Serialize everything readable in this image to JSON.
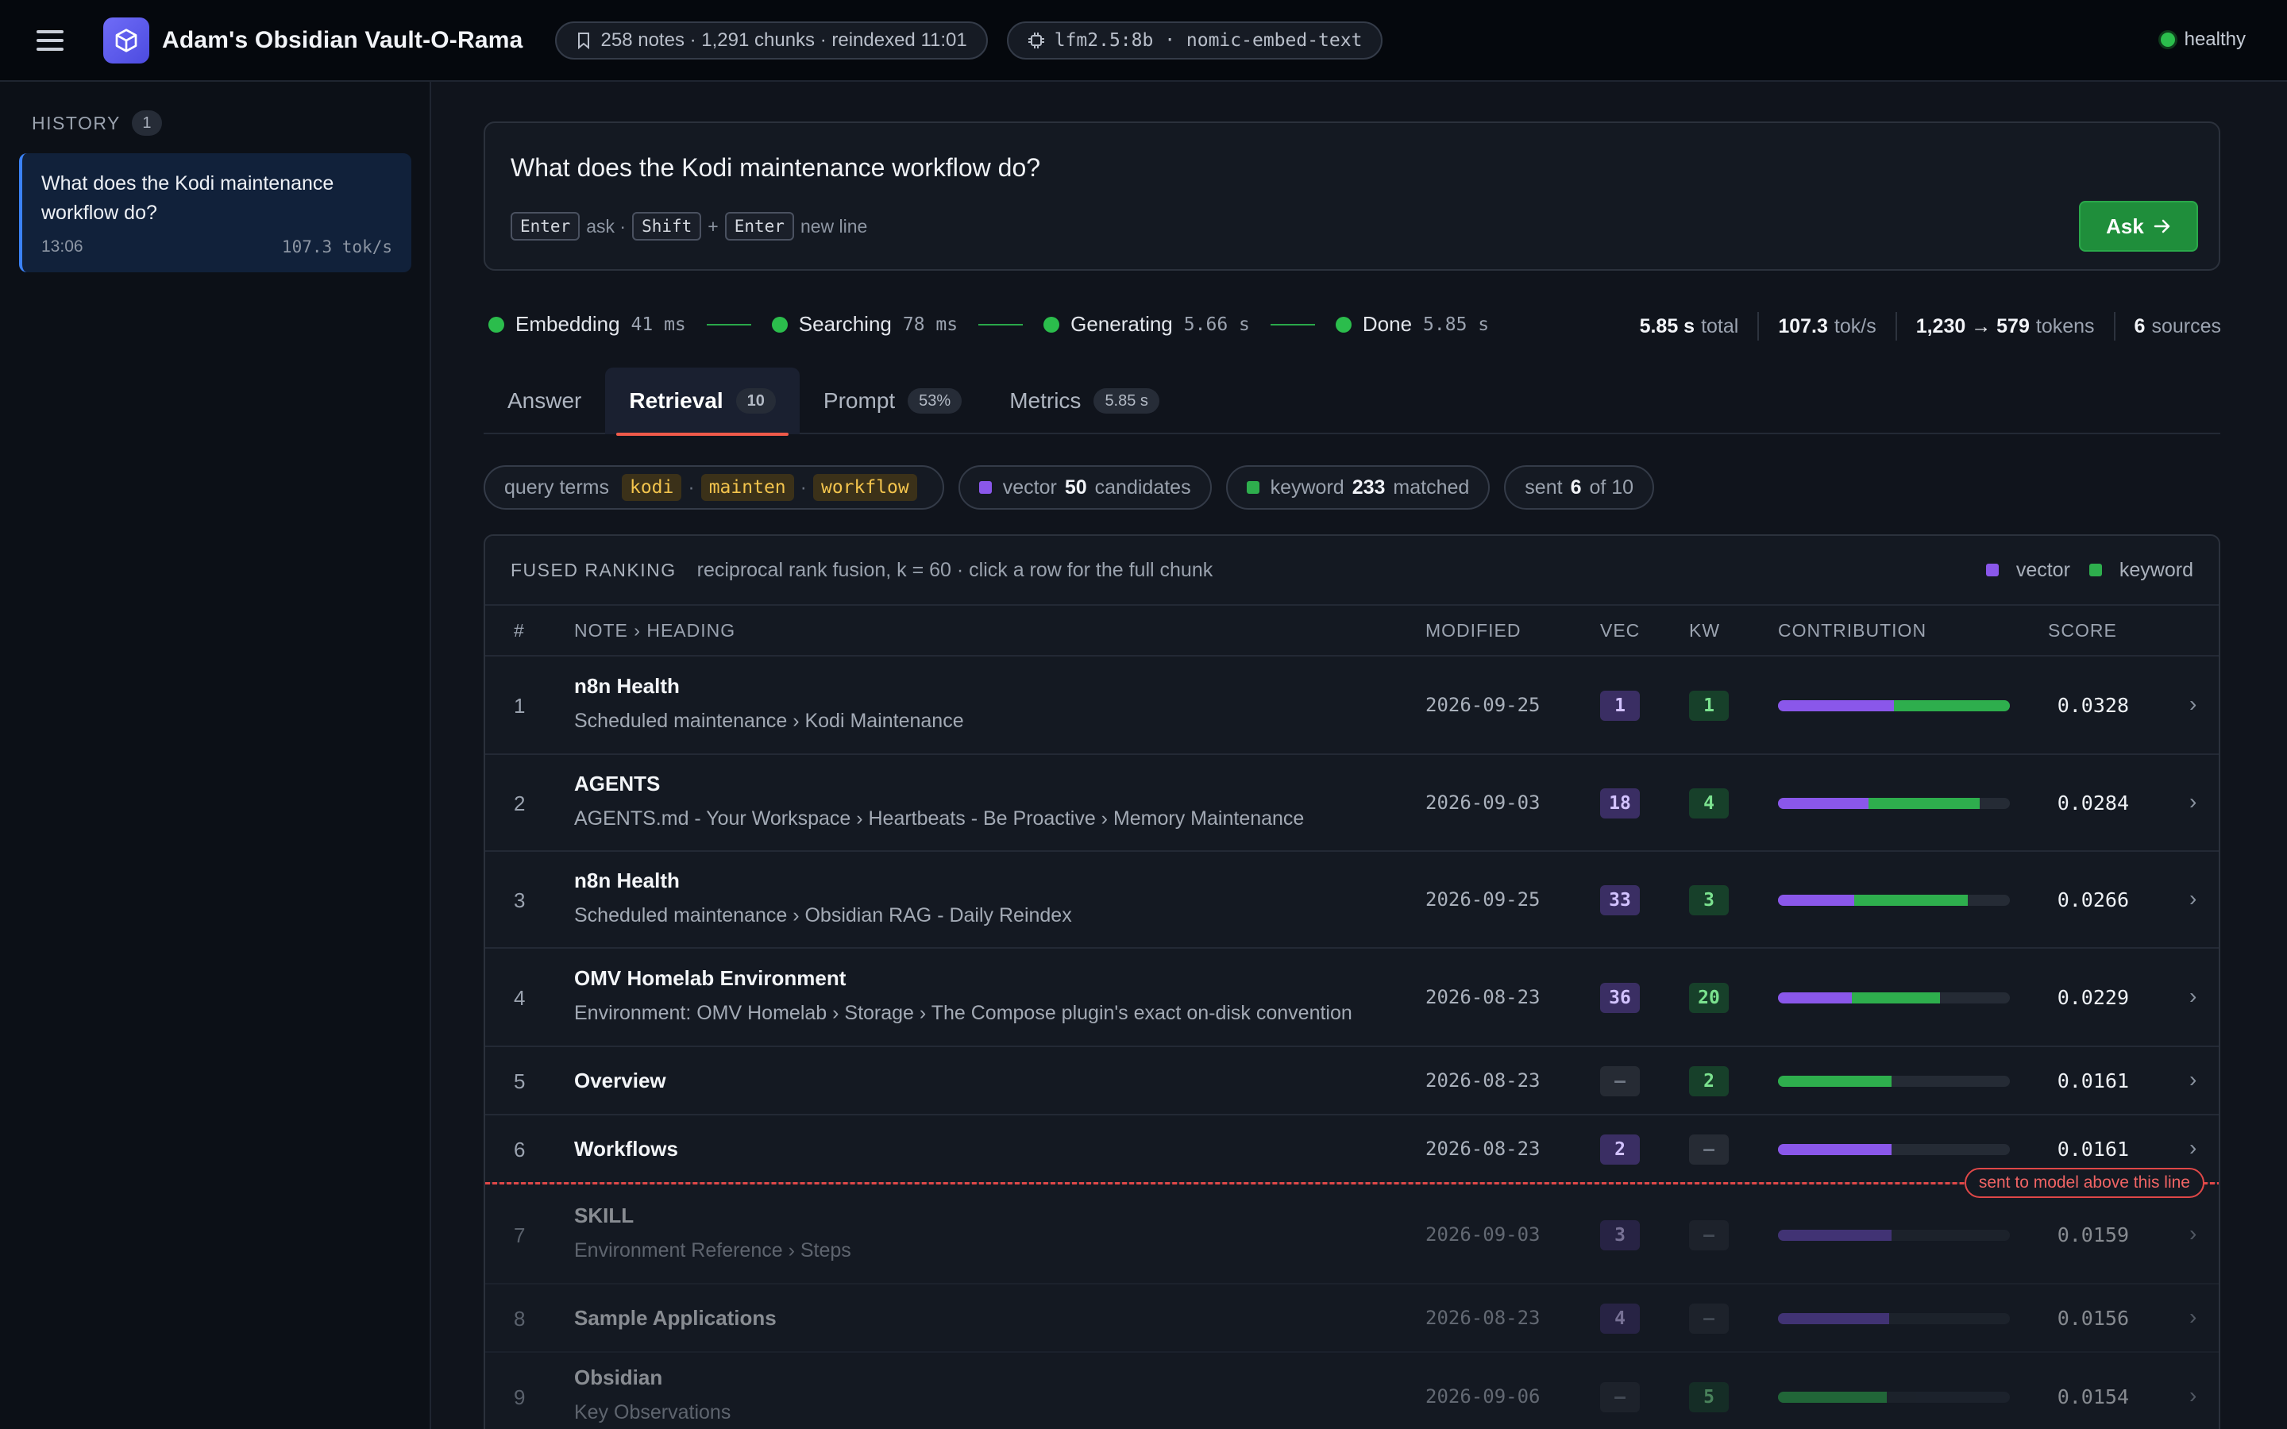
{
  "header": {
    "app_title": "Adam's Obsidian Vault-O-Rama",
    "notes_status": "258 notes · 1,291 chunks · reindexed 11:01",
    "model_status": "lfm2.5:8b · nomic-embed-text",
    "health": "healthy"
  },
  "sidebar": {
    "history_label": "HISTORY",
    "history_count": "1",
    "items": [
      {
        "question": "What does the Kodi maintenance workflow do?",
        "time": "13:06",
        "rate": "107.3 tok/s"
      }
    ]
  },
  "ask": {
    "question": "What does the Kodi maintenance workflow do?",
    "key_enter": "Enter",
    "hint_ask": "ask ·",
    "key_shift": "Shift",
    "plus": "+",
    "key_enter2": "Enter",
    "hint_newline": "new line",
    "button_label": "Ask"
  },
  "pipeline": [
    {
      "label": "Embedding",
      "time": "41 ms"
    },
    {
      "label": "Searching",
      "time": "78 ms"
    },
    {
      "label": "Generating",
      "time": "5.66 s"
    },
    {
      "label": "Done",
      "time": "5.85 s"
    }
  ],
  "stats": {
    "total_value": "5.85 s",
    "total_label": "total",
    "rate_value": "107.3",
    "rate_label": "tok/s",
    "tokens_value": "1,230 → 579",
    "tokens_label": "tokens",
    "sources_value": "6",
    "sources_label": "sources"
  },
  "tabs": [
    {
      "label": "Answer",
      "badge": ""
    },
    {
      "label": "Retrieval",
      "badge": "10"
    },
    {
      "label": "Prompt",
      "badge": "53%"
    },
    {
      "label": "Metrics",
      "badge": "5.85 s"
    }
  ],
  "chips": {
    "query_label": "query terms",
    "terms": [
      "kodi",
      "mainten",
      "workflow"
    ],
    "term_sep": "·",
    "vector_label": "vector",
    "vector_count": "50",
    "vector_suffix": "candidates",
    "keyword_label": "keyword",
    "keyword_count": "233",
    "keyword_suffix": "matched",
    "sent_label": "sent",
    "sent_count": "6",
    "sent_suffix": "of 10"
  },
  "ranking": {
    "title": "FUSED RANKING",
    "description": "reciprocal rank fusion, k = 60 · click a row for the full chunk",
    "legend_vector": "vector",
    "legend_keyword": "keyword",
    "columns": {
      "num": "#",
      "note": "NOTE › HEADING",
      "modified": "MODIFIED",
      "vec": "VEC",
      "kw": "KW",
      "contribution": "CONTRIBUTION",
      "score": "SCORE"
    },
    "cutoff_label": "sent to model above this line",
    "rows": [
      {
        "rank": "1",
        "note": "n8n Health",
        "heading": "Scheduled maintenance › Kodi Maintenance",
        "modified": "2026-09-25",
        "vec": "1",
        "kw": "1",
        "vec_share": 0.5,
        "kw_share": 0.5,
        "score": "0.0328"
      },
      {
        "rank": "2",
        "note": "AGENTS",
        "heading": "AGENTS.md - Your Workspace › Heartbeats - Be Proactive › Memory Maintenance",
        "modified": "2026-09-03",
        "vec": "18",
        "kw": "4",
        "vec_share": 0.39,
        "kw_share": 0.48,
        "score": "0.0284"
      },
      {
        "rank": "3",
        "note": "n8n Health",
        "heading": "Scheduled maintenance › Obsidian RAG - Daily Reindex",
        "modified": "2026-09-25",
        "vec": "33",
        "kw": "3",
        "vec_share": 0.33,
        "kw_share": 0.49,
        "score": "0.0266"
      },
      {
        "rank": "4",
        "note": "OMV Homelab Environment",
        "heading": "Environment: OMV Homelab › Storage › The Compose plugin's exact on-disk convention",
        "modified": "2026-08-23",
        "vec": "36",
        "kw": "20",
        "vec_share": 0.32,
        "kw_share": 0.38,
        "score": "0.0229"
      },
      {
        "rank": "5",
        "note": "Overview",
        "heading": "",
        "modified": "2026-08-23",
        "vec": "–",
        "kw": "2",
        "vec_share": 0,
        "kw_share": 0.49,
        "score": "0.0161"
      },
      {
        "rank": "6",
        "note": "Workflows",
        "heading": "",
        "modified": "2026-08-23",
        "vec": "2",
        "kw": "–",
        "vec_share": 0.49,
        "kw_share": 0,
        "score": "0.0161"
      },
      {
        "rank": "7",
        "note": "SKILL",
        "heading": "Environment Reference › Steps",
        "modified": "2026-09-03",
        "vec": "3",
        "kw": "–",
        "vec_share": 0.49,
        "kw_share": 0,
        "score": "0.0159"
      },
      {
        "rank": "8",
        "note": "Sample Applications",
        "heading": "",
        "modified": "2026-08-23",
        "vec": "4",
        "kw": "–",
        "vec_share": 0.48,
        "kw_share": 0,
        "score": "0.0156"
      },
      {
        "rank": "9",
        "note": "Obsidian",
        "heading": "Key Observations",
        "modified": "2026-09-06",
        "vec": "–",
        "kw": "5",
        "vec_share": 0,
        "kw_share": 0.47,
        "score": "0.0154"
      }
    ]
  },
  "colors": {
    "vector": "#8a57ea",
    "keyword": "#2eae4d",
    "accent": "#1f8e3b",
    "cutoff": "#e04848"
  }
}
